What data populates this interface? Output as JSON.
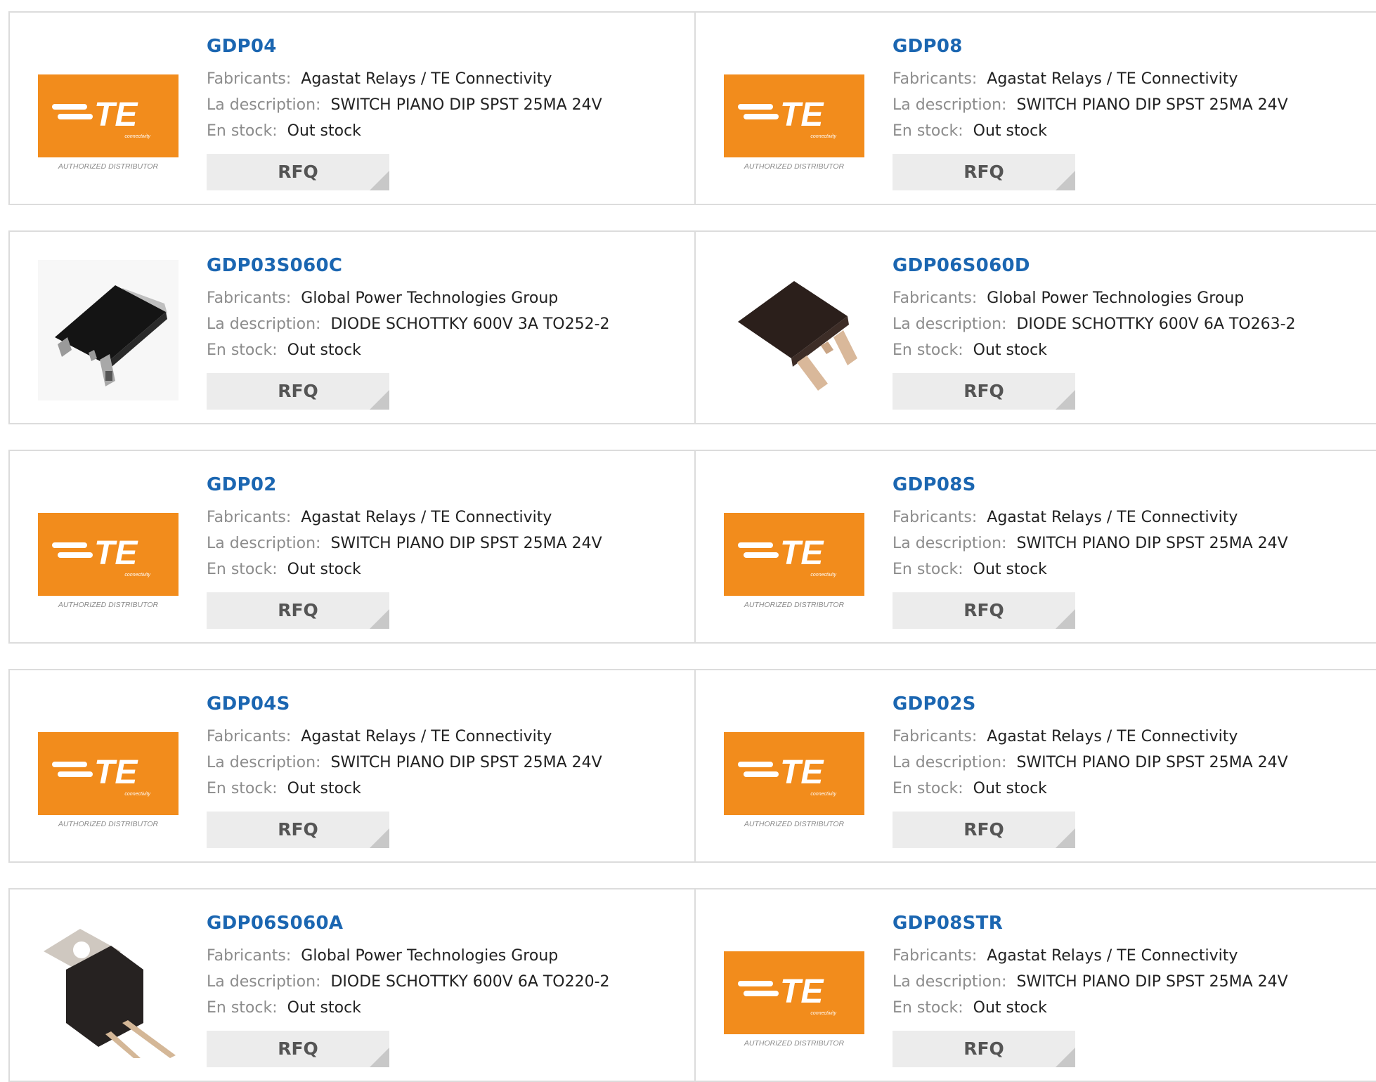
{
  "labels": {
    "manufacturer": "Fabricants:",
    "description": "La description:",
    "stock": "En stock:"
  },
  "logo": {
    "mark": "TE",
    "tagline": "connectivity",
    "caption": "AUTHORIZED DISTRIBUTOR",
    "color": "#f28c1c"
  },
  "products": [
    {
      "part": "GDP04",
      "manufacturer": "Agastat Relays / TE Connectivity",
      "description": "SWITCH PIANO DIP SPST 25MA 24V",
      "stock": "Out stock",
      "rfq": "RFQ",
      "image": "te-logo"
    },
    {
      "part": "GDP08",
      "manufacturer": "Agastat Relays / TE Connectivity",
      "description": "SWITCH PIANO DIP SPST 25MA 24V",
      "stock": "Out stock",
      "rfq": "RFQ",
      "image": "te-logo"
    },
    {
      "part": "GDP03S060C",
      "manufacturer": "Global Power Technologies Group",
      "description": "DIODE SCHOTTKY 600V 3A TO252-2",
      "stock": "Out stock",
      "rfq": "RFQ",
      "image": "to252-package"
    },
    {
      "part": "GDP06S060D",
      "manufacturer": "Global Power Technologies Group",
      "description": "DIODE SCHOTTKY 600V 6A TO263-2",
      "stock": "Out stock",
      "rfq": "RFQ",
      "image": "to263-package"
    },
    {
      "part": "GDP02",
      "manufacturer": "Agastat Relays / TE Connectivity",
      "description": "SWITCH PIANO DIP SPST 25MA 24V",
      "stock": "Out stock",
      "rfq": "RFQ",
      "image": "te-logo"
    },
    {
      "part": "GDP08S",
      "manufacturer": "Agastat Relays / TE Connectivity",
      "description": "SWITCH PIANO DIP SPST 25MA 24V",
      "stock": "Out stock",
      "rfq": "RFQ",
      "image": "te-logo"
    },
    {
      "part": "GDP04S",
      "manufacturer": "Agastat Relays / TE Connectivity",
      "description": "SWITCH PIANO DIP SPST 25MA 24V",
      "stock": "Out stock",
      "rfq": "RFQ",
      "image": "te-logo"
    },
    {
      "part": "GDP02S",
      "manufacturer": "Agastat Relays / TE Connectivity",
      "description": "SWITCH PIANO DIP SPST 25MA 24V",
      "stock": "Out stock",
      "rfq": "RFQ",
      "image": "te-logo"
    },
    {
      "part": "GDP06S060A",
      "manufacturer": "Global Power Technologies Group",
      "description": "DIODE SCHOTTKY 600V 6A TO220-2",
      "stock": "Out stock",
      "rfq": "RFQ",
      "image": "to220-package"
    },
    {
      "part": "GDP08STR",
      "manufacturer": "Agastat Relays / TE Connectivity",
      "description": "SWITCH PIANO DIP SPST 25MA 24V",
      "stock": "Out stock",
      "rfq": "RFQ",
      "image": "te-logo"
    }
  ]
}
